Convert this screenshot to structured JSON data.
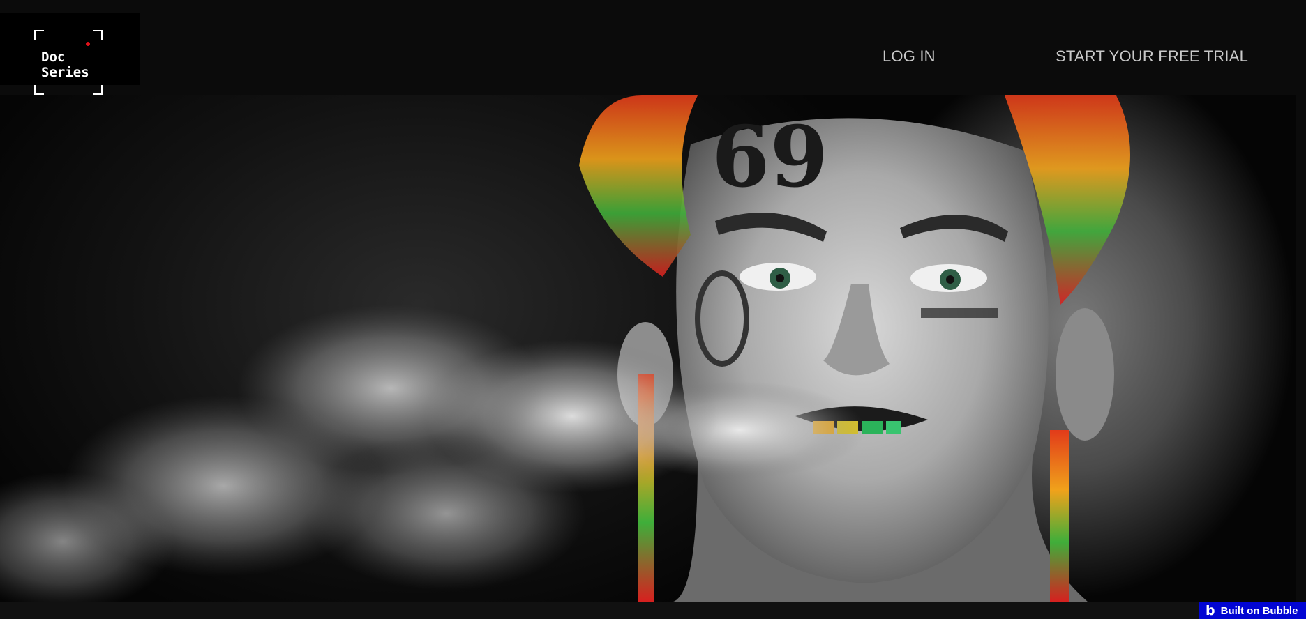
{
  "header": {
    "logo": {
      "line1": "Doc",
      "line2": "Series",
      "icon": "camera-frame-icon",
      "dot_color": "#e0121a"
    },
    "nav": {
      "login_label": "LOG IN",
      "trial_label": "START YOUR FREE TRIAL"
    }
  },
  "hero": {
    "image": "documentary-poster-smoke-portrait"
  },
  "badge": {
    "label": "Built on Bubble",
    "icon": "bubble-logo-icon",
    "color": "#0205d3"
  },
  "colors": {
    "background": "#0b0b0b",
    "nav_text": "#c9c9c9"
  }
}
